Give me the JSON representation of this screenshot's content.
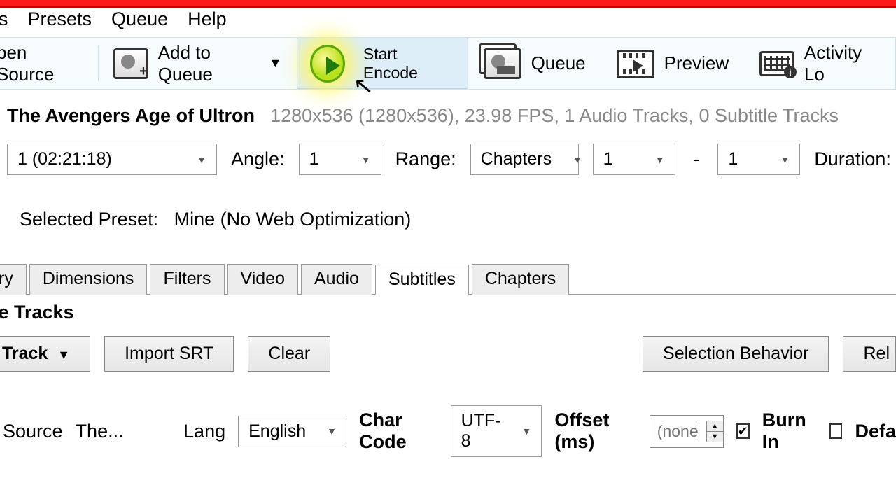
{
  "menu": {
    "items": [
      "ls",
      "Presets",
      "Queue",
      "Help"
    ]
  },
  "toolbar": {
    "open_source": "pen Source",
    "add_to_queue": "Add to Queue",
    "start_encode": "Start Encode",
    "queue": "Queue",
    "preview": "Preview",
    "activity_log": "Activity Lo"
  },
  "source": {
    "title": "The Avengers Age of Ultron",
    "info": "1280x536 (1280x536), 23.98 FPS, 1 Audio Tracks, 0 Subtitle Tracks"
  },
  "controls": {
    "title_select": "1 (02:21:18)",
    "angle_label": "Angle:",
    "angle_value": "1",
    "range_label": "Range:",
    "range_mode": "Chapters",
    "range_from": "1",
    "range_to": "1",
    "duration_label": "Duration:"
  },
  "preset": {
    "label": "Selected Preset:",
    "value": "Mine (No Web Optimization)"
  },
  "tabs": [
    "ry",
    "Dimensions",
    "Filters",
    "Video",
    "Audio",
    "Subtitles",
    "Chapters"
  ],
  "active_tab": 5,
  "subtitle_tracks_label": "le Tracks",
  "buttons": {
    "track": "Track",
    "import_srt": "Import SRT",
    "clear": "Clear",
    "selection_behavior": "Selection Behavior",
    "reload": "Rel"
  },
  "subtitle_row": {
    "source_label": "Source",
    "source_value": "The...",
    "lang_label": "Lang",
    "lang_value": "English",
    "charcode_label": "Char Code",
    "charcode_value": "UTF-8",
    "offset_label": "Offset (ms)",
    "offset_placeholder": "(none)",
    "burn_in_label": "Burn In",
    "burn_in_checked": true,
    "default_label": "Defa",
    "default_checked": false
  }
}
